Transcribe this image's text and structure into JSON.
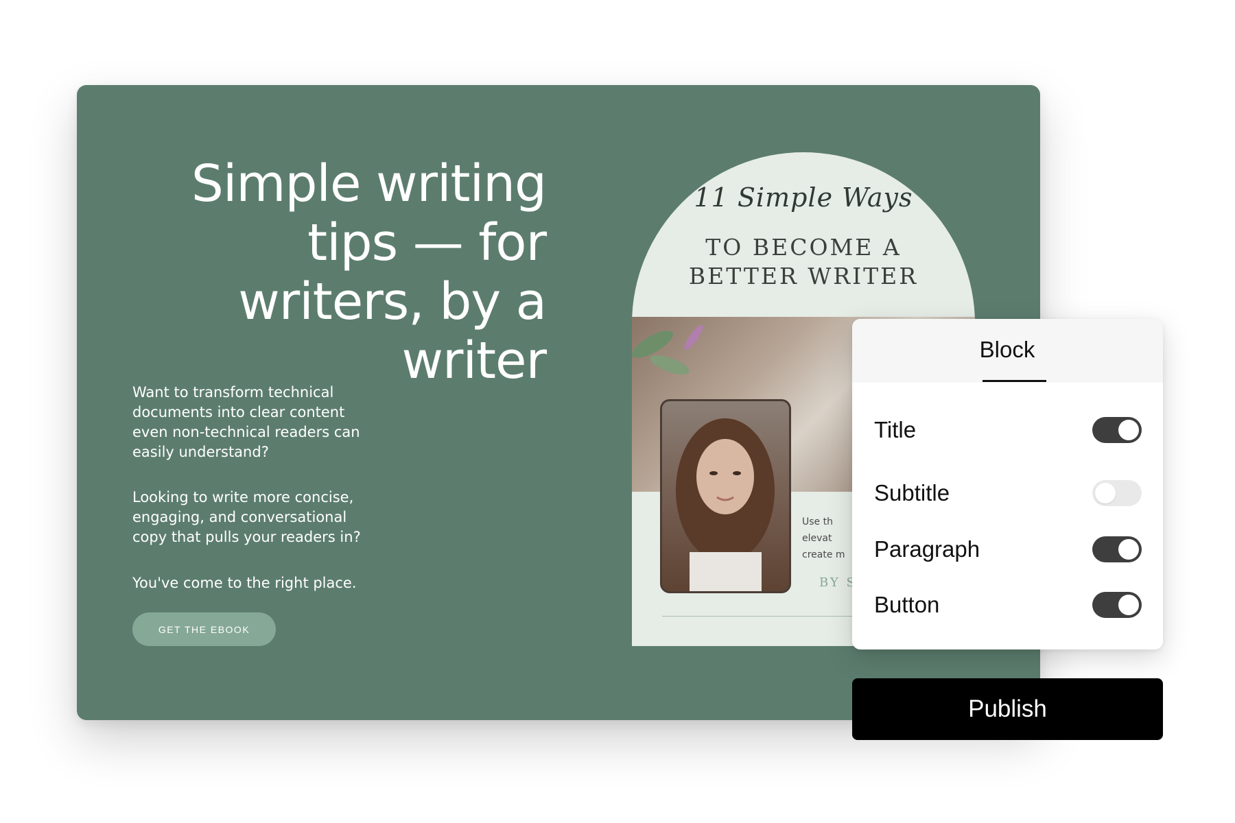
{
  "landing": {
    "headline": "Simple writing tips — for writers, by a writer",
    "paragraph_1": "Want to transform technical documents into clear content even non-technical readers can easily understand?",
    "paragraph_2": "Looking to write more concise, engaging, and conversational copy that pulls your readers in?",
    "paragraph_3": "You've come to the right place.",
    "cta_label": "GET THE EBOOK"
  },
  "ebook": {
    "script_title": "11 Simple Ways",
    "title_line_1": "TO BECOME A",
    "title_line_2": "BETTER WRITER",
    "blurb_lines": [
      "Use th",
      "elevat",
      "create m"
    ],
    "byline": "BY S"
  },
  "panel": {
    "tab_label": "Block",
    "rows": [
      {
        "label": "Title",
        "state": "on"
      },
      {
        "label": "Subtitle",
        "state": "off"
      },
      {
        "label": "Paragraph",
        "state": "on"
      },
      {
        "label": "Button",
        "state": "on"
      }
    ]
  },
  "publish_label": "Publish",
  "colors": {
    "card_green": "#5c7d6e",
    "cta_green": "#86a897",
    "toggle_on": "#3e3e3e",
    "toggle_off": "#e9e9e9",
    "publish_bg": "#000000"
  }
}
